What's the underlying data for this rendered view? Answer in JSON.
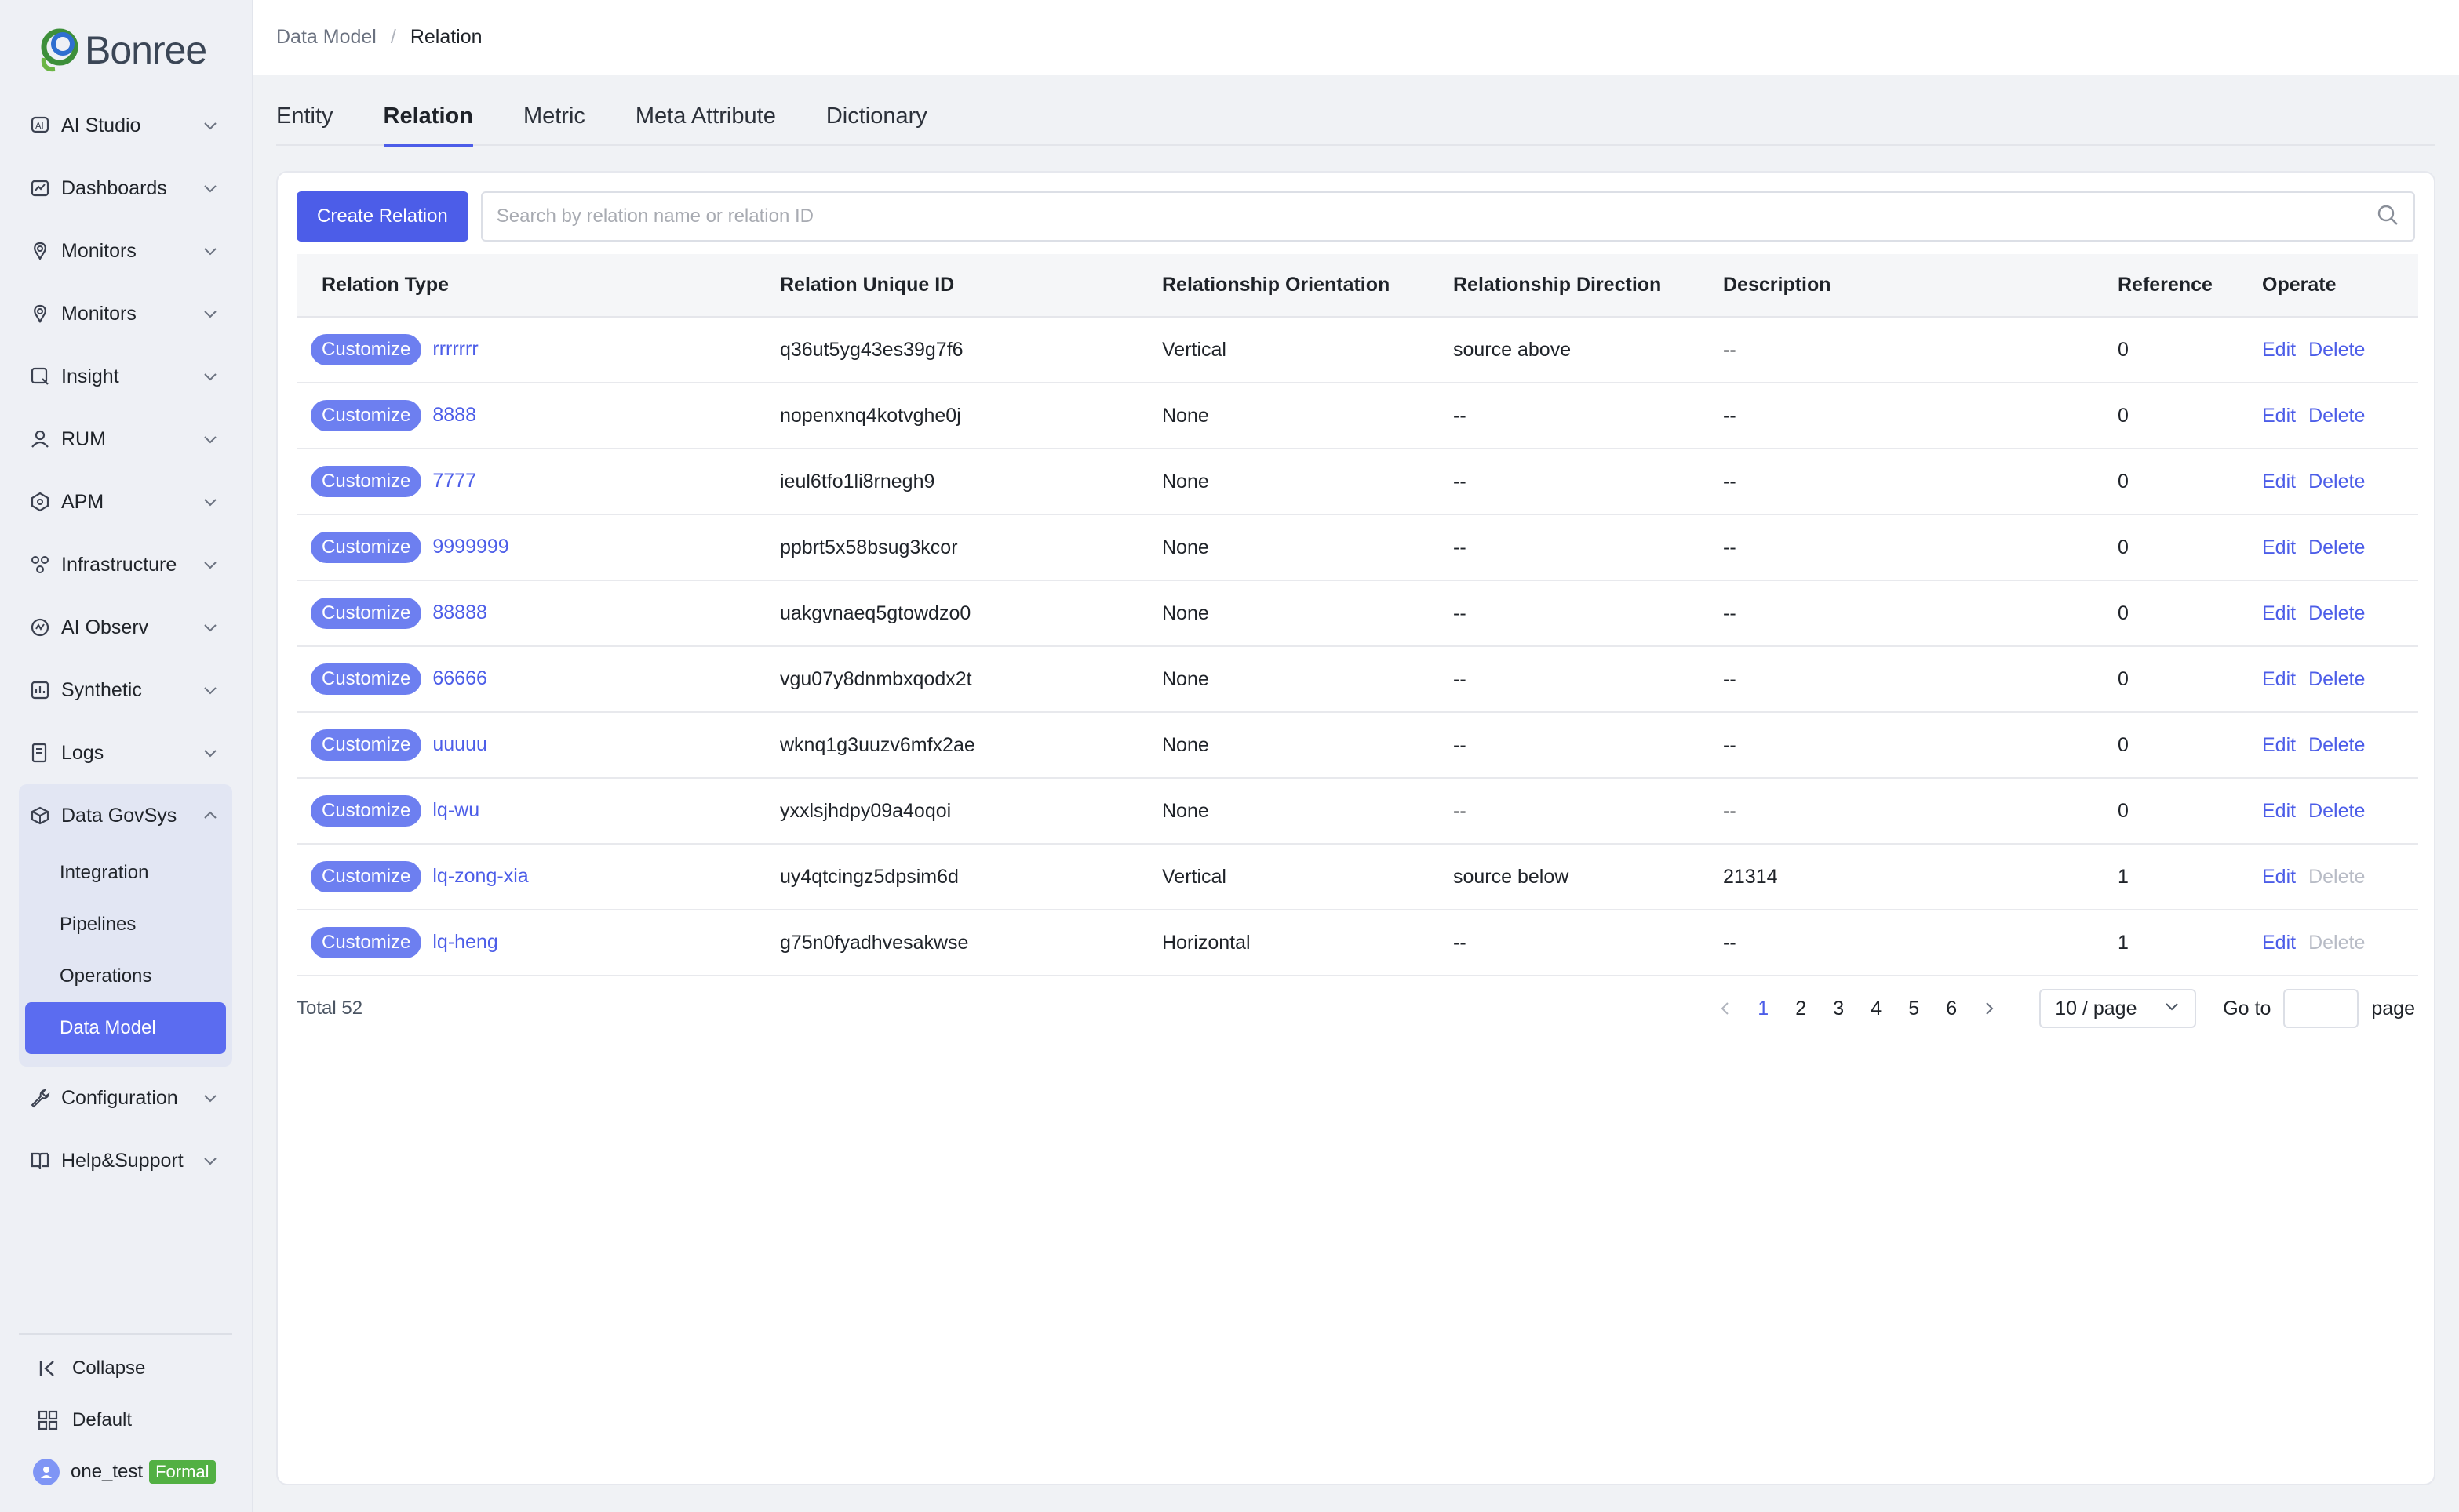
{
  "brand": {
    "name": "Bonree"
  },
  "sidebar": {
    "items": [
      {
        "label": "AI Studio",
        "icon": "ai-studio-icon"
      },
      {
        "label": "Dashboards",
        "icon": "dashboard-icon"
      },
      {
        "label": "Monitors",
        "icon": "monitor-icon"
      },
      {
        "label": "Monitors",
        "icon": "monitor-icon"
      },
      {
        "label": "Insight",
        "icon": "insight-icon"
      },
      {
        "label": "RUM",
        "icon": "user-icon"
      },
      {
        "label": "APM",
        "icon": "apm-icon"
      },
      {
        "label": "Infrastructure",
        "icon": "infrastructure-icon"
      },
      {
        "label": "AI Observ",
        "icon": "ai-observ-icon"
      },
      {
        "label": "Synthetic",
        "icon": "synthetic-icon"
      },
      {
        "label": "Logs",
        "icon": "logs-icon"
      }
    ],
    "group": {
      "label": "Data GovSys",
      "children": [
        "Integration",
        "Pipelines",
        "Operations",
        "Data Model"
      ],
      "active": "Data Model"
    },
    "after_items": [
      {
        "label": "Configuration",
        "icon": "wrench-icon"
      },
      {
        "label": "Help&Support",
        "icon": "book-icon"
      }
    ],
    "bottom": {
      "collapse": "Collapse",
      "workspace": "Default",
      "user": "one_test",
      "badge": "Formal"
    }
  },
  "breadcrumb": {
    "parent": "Data Model",
    "separator": "/",
    "current": "Relation"
  },
  "tabs": [
    "Entity",
    "Relation",
    "Metric",
    "Meta Attribute",
    "Dictionary"
  ],
  "active_tab": "Relation",
  "toolbar": {
    "create_label": "Create Relation",
    "search_placeholder": "Search by relation name or relation ID"
  },
  "table": {
    "columns": [
      "Relation Type",
      "Relation Unique ID",
      "Relationship Orientation",
      "Relationship Direction",
      "Description",
      "Reference",
      "Operate"
    ],
    "rows": [
      {
        "tag": "Customize",
        "name": "rrrrrrr",
        "id": "q36ut5yg43es39g7f6",
        "orientation": "Vertical",
        "direction": "source above",
        "description": "--",
        "reference": "0",
        "edit": "Edit",
        "delete": "Delete"
      },
      {
        "tag": "Customize",
        "name": "8888",
        "id": "nopenxnq4kotvghe0j",
        "orientation": "None",
        "direction": "--",
        "description": "--",
        "reference": "0",
        "edit": "Edit",
        "delete": "Delete"
      },
      {
        "tag": "Customize",
        "name": "7777",
        "id": "ieul6tfo1li8rnegh9",
        "orientation": "None",
        "direction": "--",
        "description": "--",
        "reference": "0",
        "edit": "Edit",
        "delete": "Delete"
      },
      {
        "tag": "Customize",
        "name": "9999999",
        "id": "ppbrt5x58bsug3kcor",
        "orientation": "None",
        "direction": "--",
        "description": "--",
        "reference": "0",
        "edit": "Edit",
        "delete": "Delete"
      },
      {
        "tag": "Customize",
        "name": "88888",
        "id": "uakgvnaeq5gtowdzo0",
        "orientation": "None",
        "direction": "--",
        "description": "--",
        "reference": "0",
        "edit": "Edit",
        "delete": "Delete"
      },
      {
        "tag": "Customize",
        "name": "66666",
        "id": "vgu07y8dnmbxqodx2t",
        "orientation": "None",
        "direction": "--",
        "description": "--",
        "reference": "0",
        "edit": "Edit",
        "delete": "Delete"
      },
      {
        "tag": "Customize",
        "name": "uuuuu",
        "id": "wknq1g3uuzv6mfx2ae",
        "orientation": "None",
        "direction": "--",
        "description": "--",
        "reference": "0",
        "edit": "Edit",
        "delete": "Delete"
      },
      {
        "tag": "Customize",
        "name": "lq-wu",
        "id": "yxxlsjhdpy09a4oqoi",
        "orientation": "None",
        "direction": "--",
        "description": "--",
        "reference": "0",
        "edit": "Edit",
        "delete": "Delete"
      },
      {
        "tag": "Customize",
        "name": "lq-zong-xia",
        "id": "uy4qtcingz5dpsim6d",
        "orientation": "Vertical",
        "direction": "source below",
        "description": "21314",
        "reference": "1",
        "edit": "Edit",
        "delete": "Delete",
        "delete_disabled": true
      },
      {
        "tag": "Customize",
        "name": "lq-heng",
        "id": "g75n0fyadhvesakwse",
        "orientation": "Horizontal",
        "direction": "--",
        "description": "--",
        "reference": "1",
        "edit": "Edit",
        "delete": "Delete",
        "delete_disabled": true
      }
    ]
  },
  "pagination": {
    "total_label": "Total 52",
    "pages": [
      "1",
      "2",
      "3",
      "4",
      "5",
      "6"
    ],
    "current": "1",
    "page_size": "10 / page",
    "goto_label": "Go to",
    "page_label": "page"
  },
  "colors": {
    "accent": "#4c5de8",
    "tag": "#6d7ff0",
    "formal": "#52b043"
  }
}
